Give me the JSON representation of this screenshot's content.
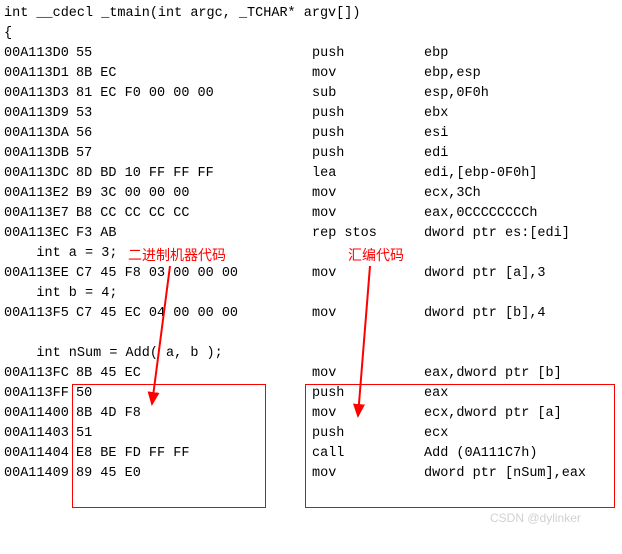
{
  "header": {
    "line1": "int __cdecl _tmain(int argc, _TCHAR* argv[])",
    "line2": "{"
  },
  "rows": [
    {
      "addr": "00A113D0",
      "bytes": "55",
      "mnem": "push",
      "ops": "ebp"
    },
    {
      "addr": "00A113D1",
      "bytes": "8B EC",
      "mnem": "mov",
      "ops": "ebp,esp"
    },
    {
      "addr": "00A113D3",
      "bytes": "81 EC F0 00 00 00",
      "mnem": "sub",
      "ops": "esp,0F0h"
    },
    {
      "addr": "00A113D9",
      "bytes": "53",
      "mnem": "push",
      "ops": "ebx"
    },
    {
      "addr": "00A113DA",
      "bytes": "56",
      "mnem": "push",
      "ops": "esi"
    },
    {
      "addr": "00A113DB",
      "bytes": "57",
      "mnem": "push",
      "ops": "edi"
    },
    {
      "addr": "00A113DC",
      "bytes": "8D BD 10 FF FF FF",
      "mnem": "lea",
      "ops": "edi,[ebp-0F0h]"
    },
    {
      "addr": "00A113E2",
      "bytes": "B9 3C 00 00 00",
      "mnem": "mov",
      "ops": "ecx,3Ch"
    },
    {
      "addr": "00A113E7",
      "bytes": "B8 CC CC CC CC",
      "mnem": "mov",
      "ops": "eax,0CCCCCCCCh"
    },
    {
      "addr": "00A113EC",
      "bytes": "F3 AB",
      "mnem": "rep stos",
      "ops": "dword ptr es:[edi]"
    }
  ],
  "src1": "    int a = 3;",
  "row_a": {
    "addr": "00A113EE",
    "bytes": "C7 45 F8 03 00 00 00",
    "mnem": "mov",
    "ops": "dword ptr [a],3"
  },
  "src2": "    int b = 4;",
  "row_b": {
    "addr": "00A113F5",
    "bytes": "C7 45 EC 04 00 00 00",
    "mnem": "mov",
    "ops": "dword ptr [b],4"
  },
  "blank": "",
  "src3": "    int nSum = Add( a, b );",
  "call_rows": [
    {
      "addr": "00A113FC",
      "bytes": "8B 45 EC",
      "mnem": "mov",
      "ops": "eax,dword ptr [b]"
    },
    {
      "addr": "00A113FF",
      "bytes": "50",
      "mnem": "push",
      "ops": "eax"
    },
    {
      "addr": "00A11400",
      "bytes": "8B 4D F8",
      "mnem": "mov",
      "ops": "ecx,dword ptr [a]"
    },
    {
      "addr": "00A11403",
      "bytes": "51",
      "mnem": "push",
      "ops": "ecx"
    },
    {
      "addr": "00A11404",
      "bytes": "E8 BE FD FF FF",
      "mnem": "call",
      "ops": "Add (0A111C7h)"
    },
    {
      "addr": "00A11409",
      "bytes": "89 45 E0",
      "mnem": "mov",
      "ops": "dword ptr [nSum],eax"
    }
  ],
  "annotations": {
    "machine_code": "二进制机器代码",
    "asm_code": "汇编代码"
  },
  "watermark": "CSDN @dylinker"
}
